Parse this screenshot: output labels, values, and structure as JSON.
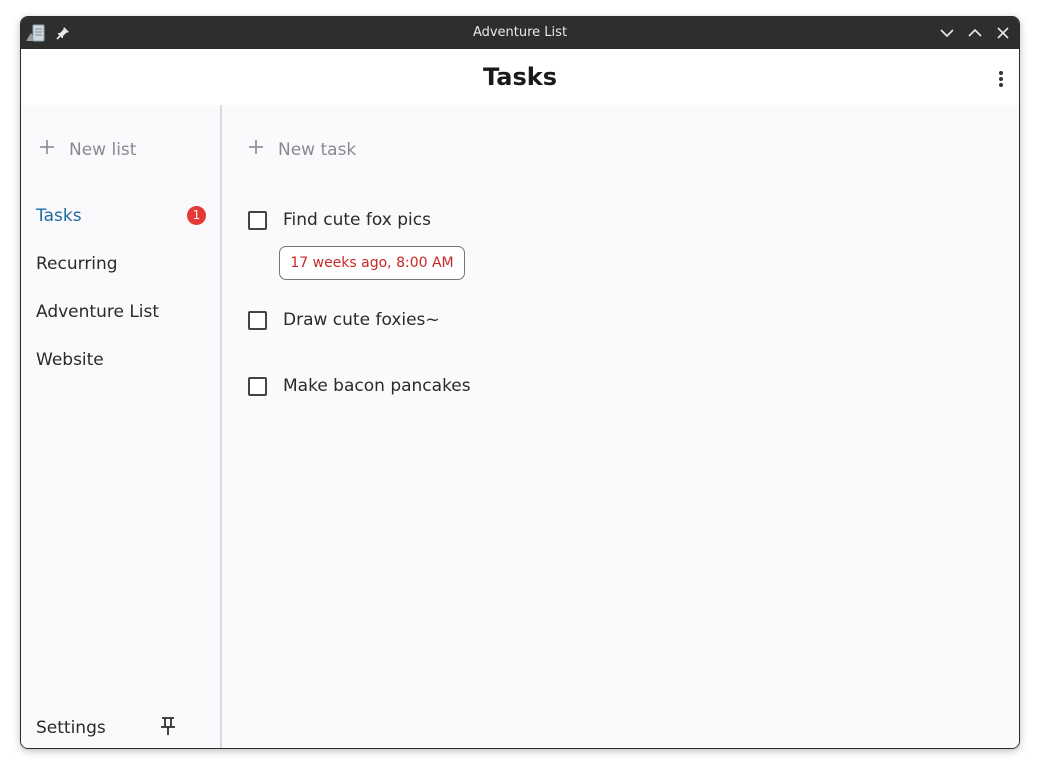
{
  "window": {
    "title": "Adventure List",
    "buttons": [
      "minimize",
      "maximize",
      "close"
    ]
  },
  "header": {
    "title": "Tasks"
  },
  "sidebar": {
    "new_list_label": "New list",
    "items": [
      {
        "label": "Tasks",
        "badge": "1",
        "active": true
      },
      {
        "label": "Recurring"
      },
      {
        "label": "Adventure List"
      },
      {
        "label": "Website"
      }
    ],
    "settings_label": "Settings"
  },
  "main": {
    "new_task_label": "New task",
    "tasks": [
      {
        "title": "Find cute fox pics",
        "due": "17 weeks ago, 8:00 AM",
        "checked": false
      },
      {
        "title": "Draw cute foxies~",
        "checked": false
      },
      {
        "title": "Make bacon pancakes",
        "checked": false
      }
    ]
  },
  "colors": {
    "accent": "#1e6ba0",
    "badge": "#e53935",
    "overdue": "#c62828",
    "titlebar": "#2e2e2e"
  },
  "icons": [
    "app-icon",
    "pin-icon",
    "chevron-down-icon",
    "chevron-up-icon",
    "close-icon",
    "more-vertical-icon",
    "plus-icon",
    "checkbox-icon"
  ]
}
